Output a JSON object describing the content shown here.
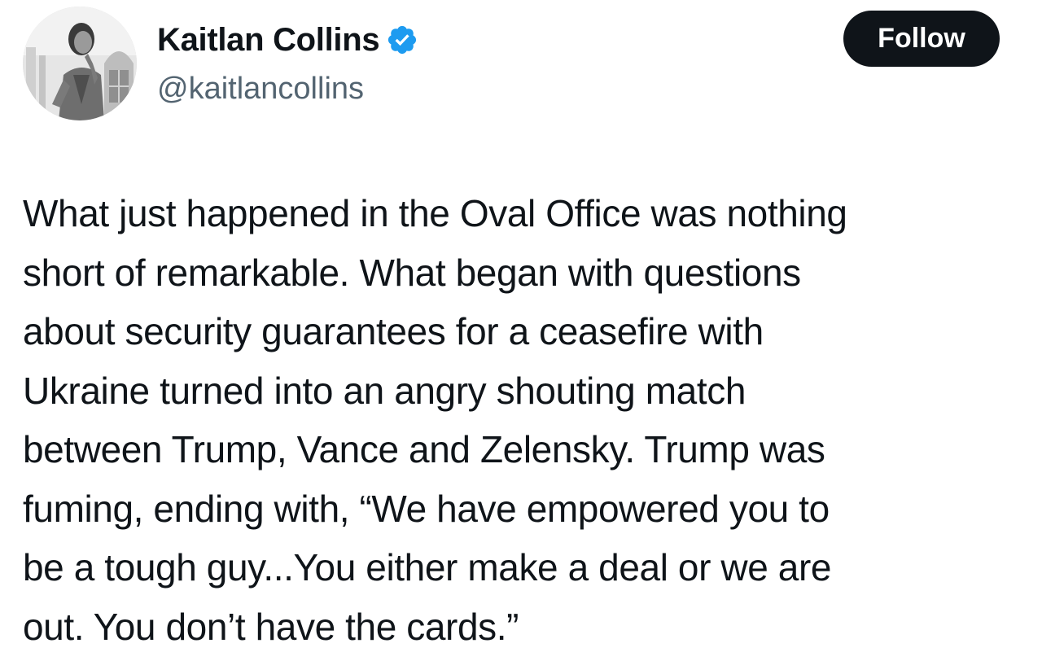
{
  "author": {
    "display_name": "Kaitlan Collins",
    "handle": "@kaitlancollins",
    "verified_icon": "verified-badge-icon",
    "avatar": "profile-photo"
  },
  "actions": {
    "follow_label": "Follow"
  },
  "tweet": {
    "text": "What just happened in the Oval Office was nothing\nshort of remarkable. What began with questions\nabout security guarantees for a ceasefire with\nUkraine turned into an angry shouting match\nbetween Trump, Vance and Zelensky. Trump was\nfuming, ending with, “We have empowered you to\nbe a tough guy...You either make a deal or we are\nout. You don’t have the cards.”"
  },
  "colors": {
    "text": "#0f1419",
    "secondary_text": "#536471",
    "follow_button_bg": "#0f1419",
    "verified_blue": "#1d9bf0"
  }
}
